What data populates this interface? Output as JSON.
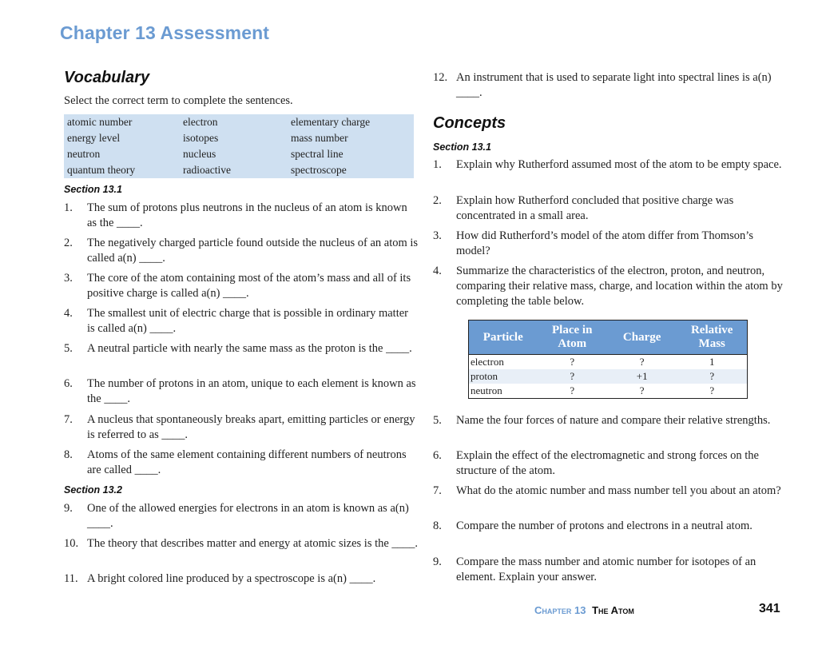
{
  "chapter_title": "Chapter 13 Assessment",
  "vocabulary": {
    "heading": "Vocabulary",
    "instructions": "Select the correct term to complete the sentences.",
    "word_bank": [
      [
        "atomic number",
        "electron",
        "elementary charge"
      ],
      [
        "energy level",
        "isotopes",
        "mass number"
      ],
      [
        "neutron",
        "nucleus",
        "spectral line"
      ],
      [
        "quantum theory",
        "radioactive",
        "spectroscope"
      ]
    ],
    "sections": [
      {
        "label": "Section 13.1",
        "questions": [
          {
            "num": "1.",
            "text": "The sum of protons plus neutrons in the nucleus of an atom is known as the ____."
          },
          {
            "num": "2.",
            "text": "The negatively charged particle found outside the nucleus of an atom is called a(n) ____."
          },
          {
            "num": "3.",
            "text": "The core of the atom containing most of the atom’s mass and all of its positive charge is called a(n) ____."
          },
          {
            "num": "4.",
            "text": "The smallest unit of electric charge that is possible in ordinary matter is called a(n) ____."
          },
          {
            "num": "5.",
            "text": "A neutral particle with nearly the same mass as the proton is the ____."
          },
          {
            "num": "6.",
            "text": "The number of protons in an atom, unique to each element is known as the ____."
          },
          {
            "num": "7.",
            "text": "A nucleus that spontaneously breaks apart, emitting particles or energy is referred to as ____."
          },
          {
            "num": "8.",
            "text": "Atoms of the same element containing different numbers of neutrons are called ____."
          }
        ]
      },
      {
        "label": "Section 13.2",
        "questions": [
          {
            "num": "9.",
            "text": "One of the allowed energies for electrons in an atom is known as a(n) ____."
          },
          {
            "num": "10.",
            "text": "The theory that describes matter and energy at atomic sizes is the ____."
          },
          {
            "num": "11.",
            "text": "A bright colored line produced by a spectroscope is a(n) ____."
          },
          {
            "num": "12.",
            "text": "An instrument that is used to separate light into spectral lines is a(n) ____."
          }
        ]
      }
    ]
  },
  "concepts": {
    "heading": "Concepts",
    "section_label": "Section 13.1",
    "questions": [
      {
        "num": "1.",
        "text": "Explain why Rutherford assumed most of the atom to be empty space."
      },
      {
        "num": "2.",
        "text": "Explain how Rutherford concluded that positive charge was concentrated in a small area."
      },
      {
        "num": "3.",
        "text": "How did Rutherford’s model of the atom differ from Thomson’s model?"
      },
      {
        "num": "4.",
        "text": "Summarize the characteristics of the electron, proton, and neutron, comparing their relative mass, charge, and location within the atom by completing the table below."
      },
      {
        "num": "5.",
        "text": "Name the four forces of nature and compare their relative strengths."
      },
      {
        "num": "6.",
        "text": "Explain the effect of the electromagnetic and strong forces on the structure of the atom."
      },
      {
        "num": "7.",
        "text": "What do the atomic number and mass number tell you about an atom?"
      },
      {
        "num": "8.",
        "text": "Compare the number of protons and electrons in a neutral atom."
      },
      {
        "num": "9.",
        "text": "Compare the mass number and atomic number for isotopes of an element. Explain your answer."
      }
    ],
    "particle_table": {
      "headers": [
        "Particle",
        "Place in Atom",
        "Charge",
        "Relative Mass"
      ],
      "rows": [
        [
          "electron",
          "?",
          "?",
          "1"
        ],
        [
          "proton",
          "?",
          "+1",
          "?"
        ],
        [
          "neutron",
          "?",
          "?",
          "?"
        ]
      ]
    }
  },
  "footer": {
    "chapter": "Chapter 13",
    "title": "The Atom",
    "page_number": "341"
  },
  "colors": {
    "accent_blue": "#6b9bd2",
    "word_bank_bg": "#cfe0f1",
    "table_alt_row": "#e8eff7"
  }
}
